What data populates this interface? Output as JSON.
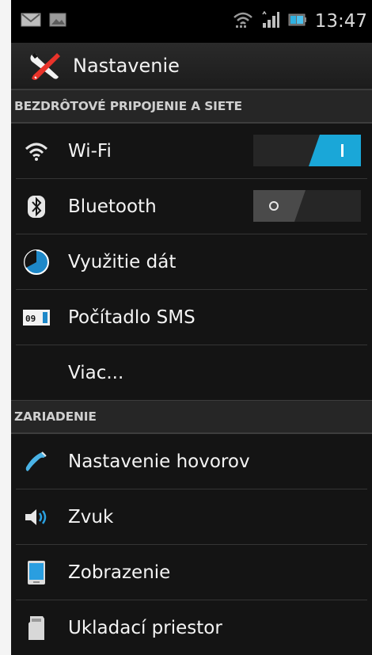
{
  "status_bar": {
    "time": "13:47",
    "left_icons": [
      "gmail-icon",
      "gallery-icon"
    ],
    "right_icons": [
      "wifi-signal-icon",
      "cell-signal-icon",
      "battery-icon"
    ]
  },
  "action_bar": {
    "title": "Nastavenie",
    "icon": "tools-icon"
  },
  "sections": [
    {
      "header": "BEZDRÔTOVÉ PRIPOJENIE A SIETE",
      "items": [
        {
          "label": "Wi-Fi",
          "icon": "wifi-icon",
          "toggle": "on"
        },
        {
          "label": "Bluetooth",
          "icon": "bluetooth-icon",
          "toggle": "off"
        },
        {
          "label": "Využitie dát",
          "icon": "data-usage-icon"
        },
        {
          "label": "Počítadlo SMS",
          "icon": "sms-counter-icon",
          "icon_text": "09"
        },
        {
          "label": "Viac...",
          "icon": ""
        }
      ]
    },
    {
      "header": "ZARIADENIE",
      "items": [
        {
          "label": "Nastavenie hovorov",
          "icon": "phone-icon"
        },
        {
          "label": "Zvuk",
          "icon": "speaker-icon"
        },
        {
          "label": "Zobrazenie",
          "icon": "display-icon"
        },
        {
          "label": "Ukladací priestor",
          "icon": "storage-icon"
        }
      ]
    }
  ],
  "colors": {
    "accent": "#1aa7d8",
    "background": "#141414",
    "section_header": "#262626"
  }
}
